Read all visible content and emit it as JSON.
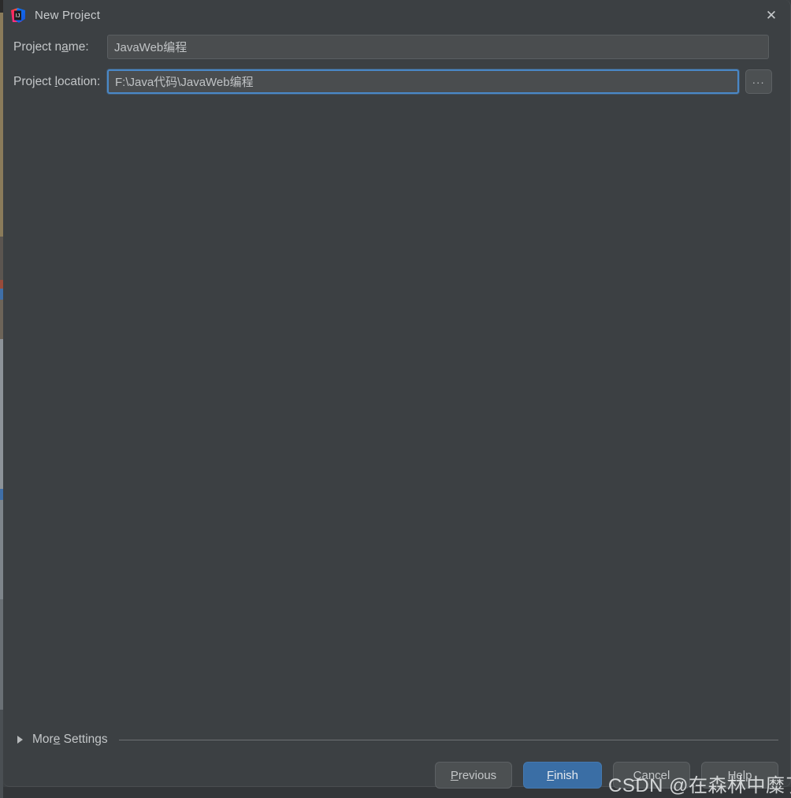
{
  "window": {
    "title": "New Project",
    "app_icon": "intellij-idea-logo",
    "close_icon": "close-icon",
    "background_color": "#3c4043",
    "accent_color": "#3a6ea5"
  },
  "form": {
    "project_name": {
      "label_prefix": "Project n",
      "label_mnemonic": "a",
      "label_suffix": "me:",
      "value": "JavaWeb编程",
      "placeholder": ""
    },
    "project_location": {
      "label_prefix": "Project ",
      "label_mnemonic": "l",
      "label_suffix": "ocation:",
      "value": "F:\\Java代码\\JavaWeb编程",
      "placeholder": "",
      "browse_label": "..."
    }
  },
  "more_settings": {
    "label_prefix": "Mor",
    "label_mnemonic": "e",
    "label_suffix": " Settings",
    "expanded": false,
    "disclosure_icon": "triangle-right-icon"
  },
  "footer": {
    "previous": {
      "prefix": "",
      "mnemonic": "P",
      "suffix": "revious"
    },
    "finish": {
      "prefix": "",
      "mnemonic": "F",
      "suffix": "inish"
    },
    "cancel": {
      "prefix": "",
      "mnemonic": "C",
      "suffix": "ancel"
    },
    "help": {
      "prefix": "",
      "mnemonic": "H",
      "suffix": "elp"
    }
  },
  "watermark": {
    "text": "CSDN @在森林中糜了鹿"
  }
}
